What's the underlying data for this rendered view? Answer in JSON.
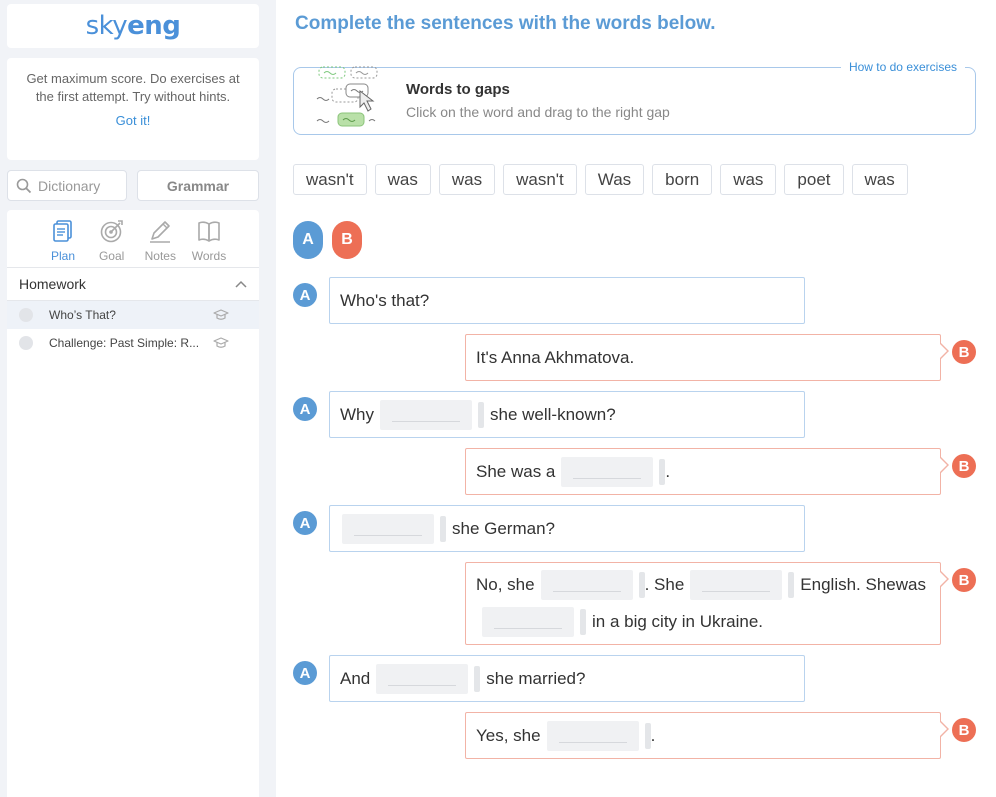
{
  "logo": {
    "light": "sky",
    "bold": "eng"
  },
  "tip": {
    "text": "Get maximum score. Do exercises at the first attempt. Try without hints.",
    "link": "Got it!"
  },
  "search": {
    "placeholder": "Dictionary"
  },
  "grammar_button": "Grammar",
  "tabs": [
    {
      "label": "Plan",
      "icon": "plan-icon",
      "active": true
    },
    {
      "label": "Goal",
      "icon": "goal-icon",
      "active": false
    },
    {
      "label": "Notes",
      "icon": "notes-icon",
      "active": false
    },
    {
      "label": "Words",
      "icon": "words-icon",
      "active": false
    }
  ],
  "homework": {
    "title": "Homework",
    "lessons": [
      {
        "title": "Who’s That?"
      },
      {
        "title": "Challenge: Past Simple: R..."
      }
    ]
  },
  "exercise": {
    "heading": "Complete the sentences with the words below.",
    "instruction": {
      "link": "How to do exercises",
      "title": "Words to gaps",
      "subtitle": "Click on the word and drag to the right gap"
    },
    "words": [
      "wasn't",
      "was",
      "was",
      "wasn't",
      "Was",
      "born",
      "was",
      "poet",
      "was"
    ],
    "speakers": {
      "a": "A",
      "b": "B"
    },
    "dialogue": {
      "l1": "Who's that?",
      "l2": "It's Anna Akhmatova.",
      "l3a": "Why",
      "l3b": "she well-known?",
      "l4a": "She was a",
      "l4b": ".",
      "l5b": "she German?",
      "l6a": "No, she",
      "l6b": ". She",
      "l6c": "English. She",
      "l6d": "was",
      "l6e": "in a big city in Ukraine.",
      "l7a": "And",
      "l7b": "she married?",
      "l8a": "Yes, she",
      "l8b": "."
    }
  },
  "colors": {
    "blue": "#5b9bd5",
    "orange": "#ed6f55",
    "link": "#3a8fd8"
  }
}
